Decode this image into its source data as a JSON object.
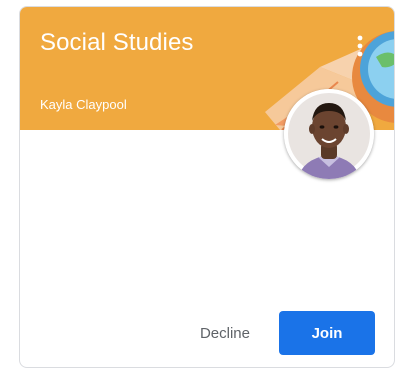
{
  "card": {
    "title": "Social Studies",
    "teacher": "Kayla Claypool",
    "banner_color": "#f0a93f",
    "more_icon": "more-vertical-icon",
    "avatar_icon": "teacher-avatar",
    "decline_label": "Decline",
    "join_label": "Join",
    "join_color": "#1a73e8"
  }
}
